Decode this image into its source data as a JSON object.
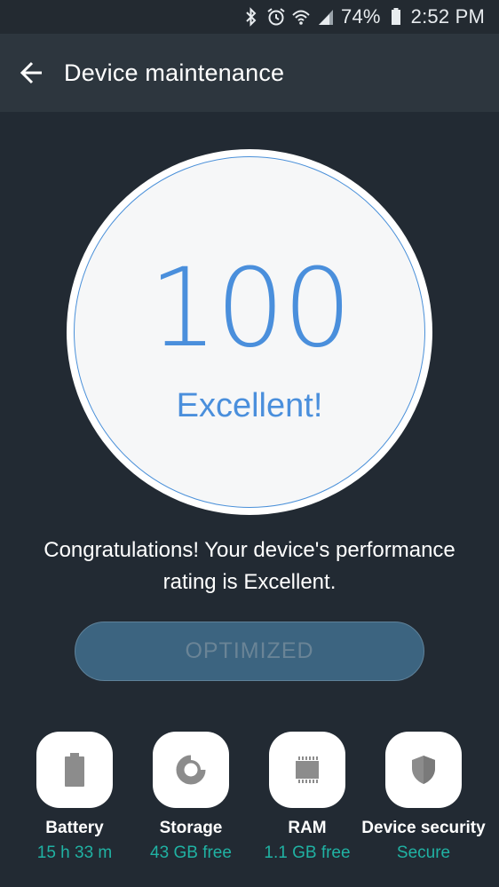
{
  "status_bar": {
    "battery_percent": "74%",
    "time": "2:52 PM",
    "icons": [
      "bluetooth-icon",
      "alarm-icon",
      "wifi-icon",
      "signal-icon",
      "battery-icon"
    ]
  },
  "app_bar": {
    "title": "Device maintenance",
    "back_icon": "back-arrow-icon"
  },
  "score": {
    "value": "100",
    "rating": "Excellent!"
  },
  "message": "Congratulations! Your device's performance rating is Excellent.",
  "action_button": {
    "label": "OPTIMIZED"
  },
  "tiles": [
    {
      "label": "Battery",
      "value": "15 h 33 m",
      "icon": "battery-icon"
    },
    {
      "label": "Storage",
      "value": "43 GB free",
      "icon": "storage-icon"
    },
    {
      "label": "RAM",
      "value": "1.1 GB free",
      "icon": "ram-chip-icon"
    },
    {
      "label": "Device security",
      "value": "Secure",
      "icon": "shield-icon"
    }
  ],
  "colors": {
    "background": "#222a33",
    "app_bar": "#2d363e",
    "score_accent": "#4a8fdc",
    "tile_value": "#20b2a3",
    "button": "#3c6480"
  }
}
